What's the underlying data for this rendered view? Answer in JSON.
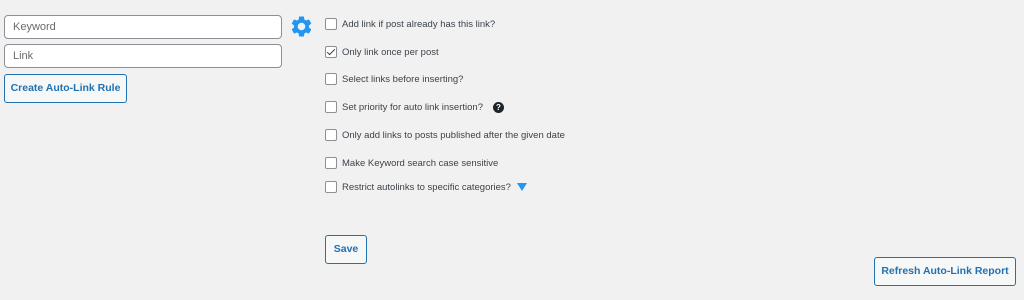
{
  "form": {
    "keyword_placeholder": "Keyword",
    "keyword_value": "",
    "link_placeholder": "Link",
    "link_value": "",
    "create_rule_label": "Create Auto-Link Rule",
    "settings_icon": "gear-icon"
  },
  "options": [
    {
      "label": "Add link if post already has this link?",
      "checked": false
    },
    {
      "label": "Only link once per post",
      "checked": true
    },
    {
      "label": "Select links before inserting?",
      "checked": false
    },
    {
      "label": "Set priority for auto link insertion?",
      "checked": false,
      "help_icon": "?"
    },
    {
      "label": "Only add links to posts published after the given date",
      "checked": false
    },
    {
      "label": "Make Keyword search case sensitive",
      "checked": false
    },
    {
      "label": "Restrict autolinks to specific categories?",
      "checked": false,
      "expand_icon": "caret-down-icon"
    }
  ],
  "actions": {
    "save_label": "Save",
    "refresh_label": "Refresh Auto-Link Report"
  },
  "colors": {
    "accent": "#2271b1",
    "gear": "#2196f3",
    "background": "#f1f1f1"
  }
}
